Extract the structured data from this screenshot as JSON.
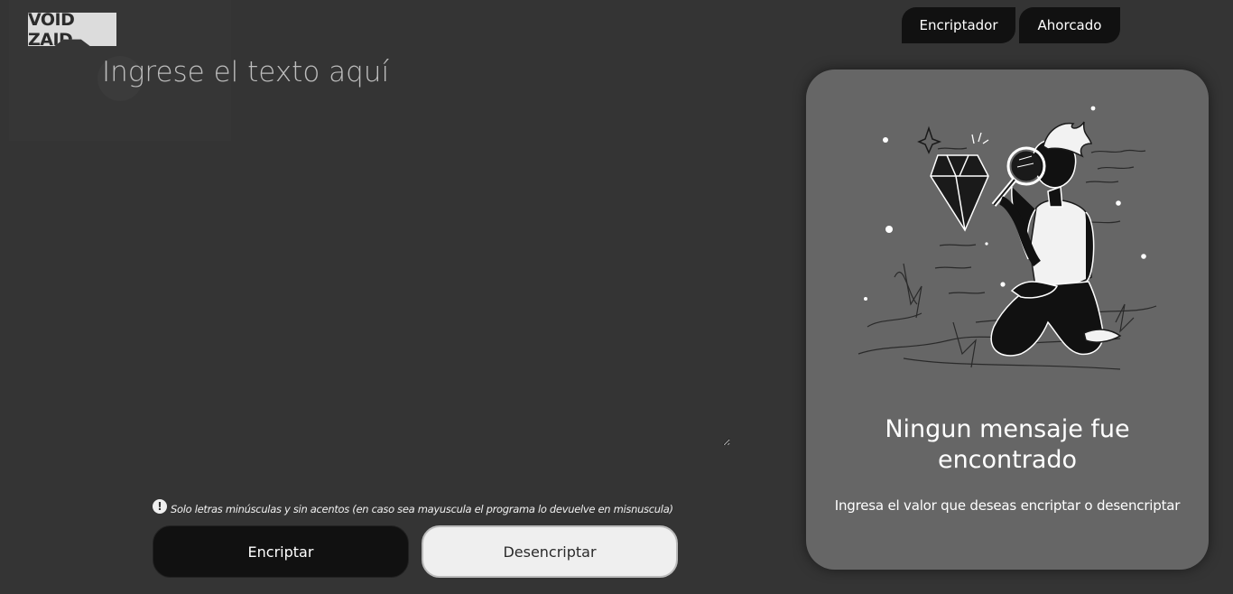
{
  "header": {
    "logo_text": "VOID ZAID",
    "tabs": [
      {
        "label": "Encriptador"
      },
      {
        "label": "Ahorcado"
      }
    ]
  },
  "editor": {
    "placeholder": "Ingrese el texto aquí",
    "value": ""
  },
  "note": {
    "icon": "exclamation-circle-icon",
    "text": "Solo letras minúsculas y sin acentos (en caso sea mayuscula el programa lo devuelve en misnuscula)"
  },
  "actions": {
    "encrypt_label": "Encriptar",
    "decrypt_label": "Desencriptar"
  },
  "result": {
    "title": "Ningun mensaje fue encontrado",
    "subtitle": "Ingresa el valor que deseas encriptar o desencriptar"
  },
  "colors": {
    "background": "#343434",
    "card": "#666666",
    "dark_button": "#111111",
    "light_button": "#efefef"
  }
}
